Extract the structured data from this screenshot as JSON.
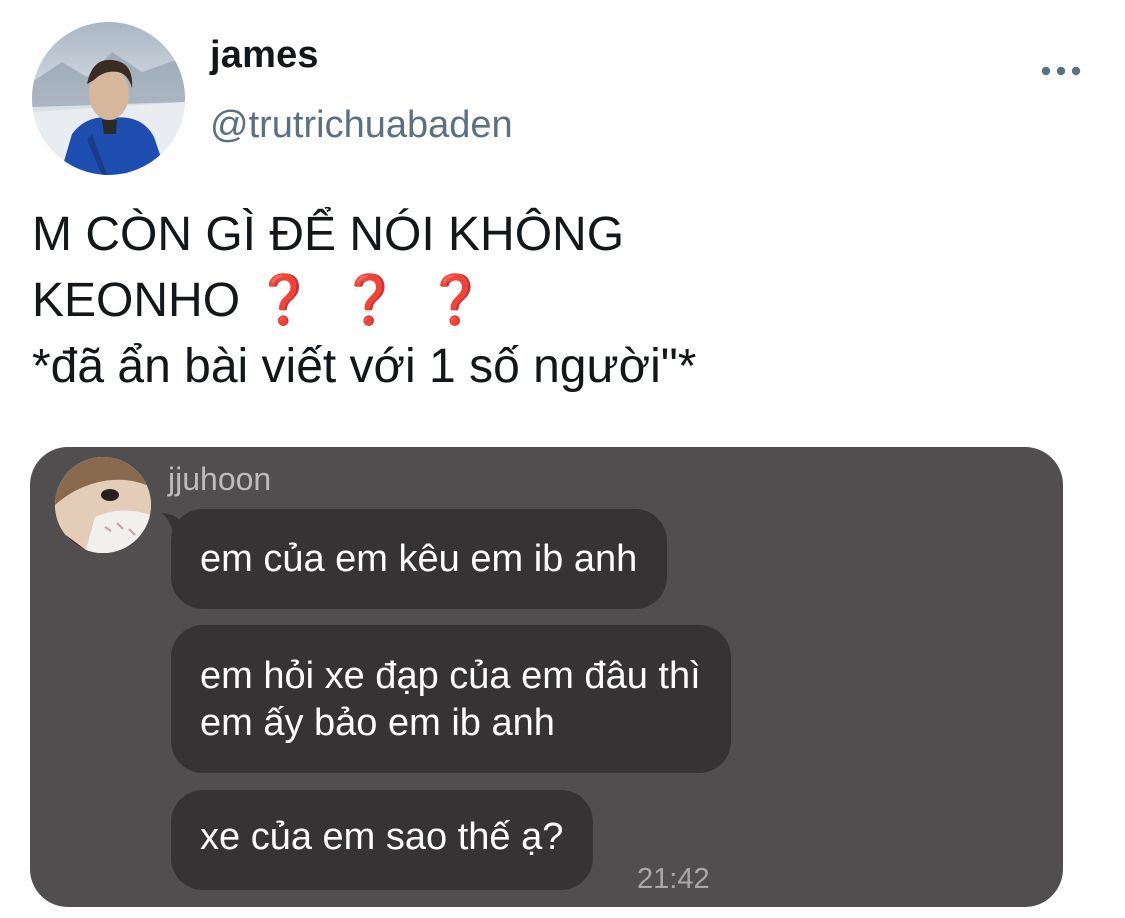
{
  "tweet": {
    "author": {
      "display_name": "james",
      "handle": "@trutrichuabaden",
      "avatar_icon": "profile-photo"
    },
    "more_icon": "more-horizontal-icon",
    "text_lines": [
      "M CÒN GÌ ĐỂ NÓI KHÔNG",
      "KEONHO",
      "*đã ẩn bài viết với 1 số người\"*"
    ],
    "emoji": "❓❓❓",
    "emoji_color": "#d42a2a"
  },
  "chat": {
    "sender": "jjuhoon",
    "messages": [
      {
        "lines": [
          "em của em kêu em ib anh"
        ]
      },
      {
        "lines": [
          "em hỏi xe đạp của em đâu thì",
          "em ấy bảo em ib anh"
        ]
      },
      {
        "lines": [
          "xe của em sao thế ạ?"
        ]
      }
    ],
    "timestamp": "21:42",
    "background_color": "#504e4f",
    "bubble_color": "#353334"
  }
}
